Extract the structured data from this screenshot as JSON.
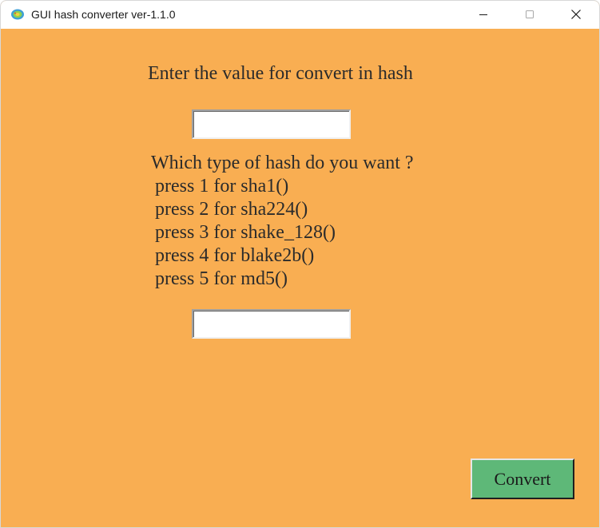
{
  "window": {
    "title": "GUI hash converter ver-1.1.0",
    "background": "#f9ae52",
    "controls": [
      "minimize-icon",
      "maximize-icon",
      "close-icon"
    ]
  },
  "form": {
    "prompt_label": "Enter the value for convert in hash",
    "value_input": {
      "value": "",
      "placeholder": ""
    },
    "question": "Which type of hash do you want ?",
    "options": [
      "press 1 for sha1()",
      "press 2 for sha224()",
      "press 3 for shake_128()",
      "press 4 for blake2b()",
      "press 5 for md5()"
    ],
    "type_input": {
      "value": "",
      "placeholder": ""
    },
    "convert_label": "Convert",
    "convert_color": "#5eb878"
  }
}
